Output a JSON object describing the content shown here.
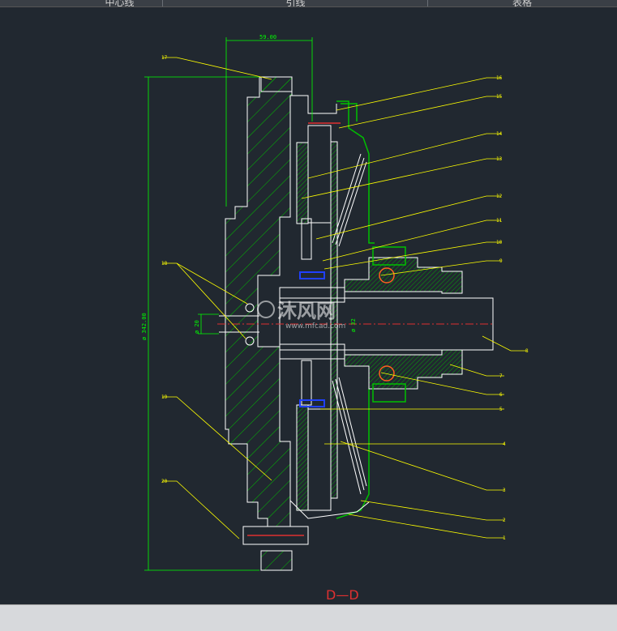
{
  "tabs": [
    {
      "label": "中心线"
    },
    {
      "label": "引线"
    },
    {
      "label": "表格"
    }
  ],
  "view_title": "D—D",
  "dimensions": {
    "top_width": "59.00",
    "overall_diameter": "ø 342.00",
    "bore_diameter": "ø 20",
    "shaft_diameter": "ø 32"
  },
  "part_numbers": [
    "1",
    "2",
    "3",
    "4",
    "5",
    "6",
    "7",
    "8",
    "9",
    "10",
    "11",
    "12",
    "13",
    "14",
    "15",
    "16",
    "17",
    "18",
    "19",
    "20"
  ],
  "watermark": {
    "text": "沐风网",
    "url": "www.mfcad.com"
  },
  "colors": {
    "background": "#212830",
    "outline": "#ffffff",
    "hatch": "#00c000",
    "leader": "#ffff00",
    "dimension": "#00ff00",
    "center": "#e03030",
    "bolt": "#2040ff",
    "bearing": "#ff6020"
  }
}
